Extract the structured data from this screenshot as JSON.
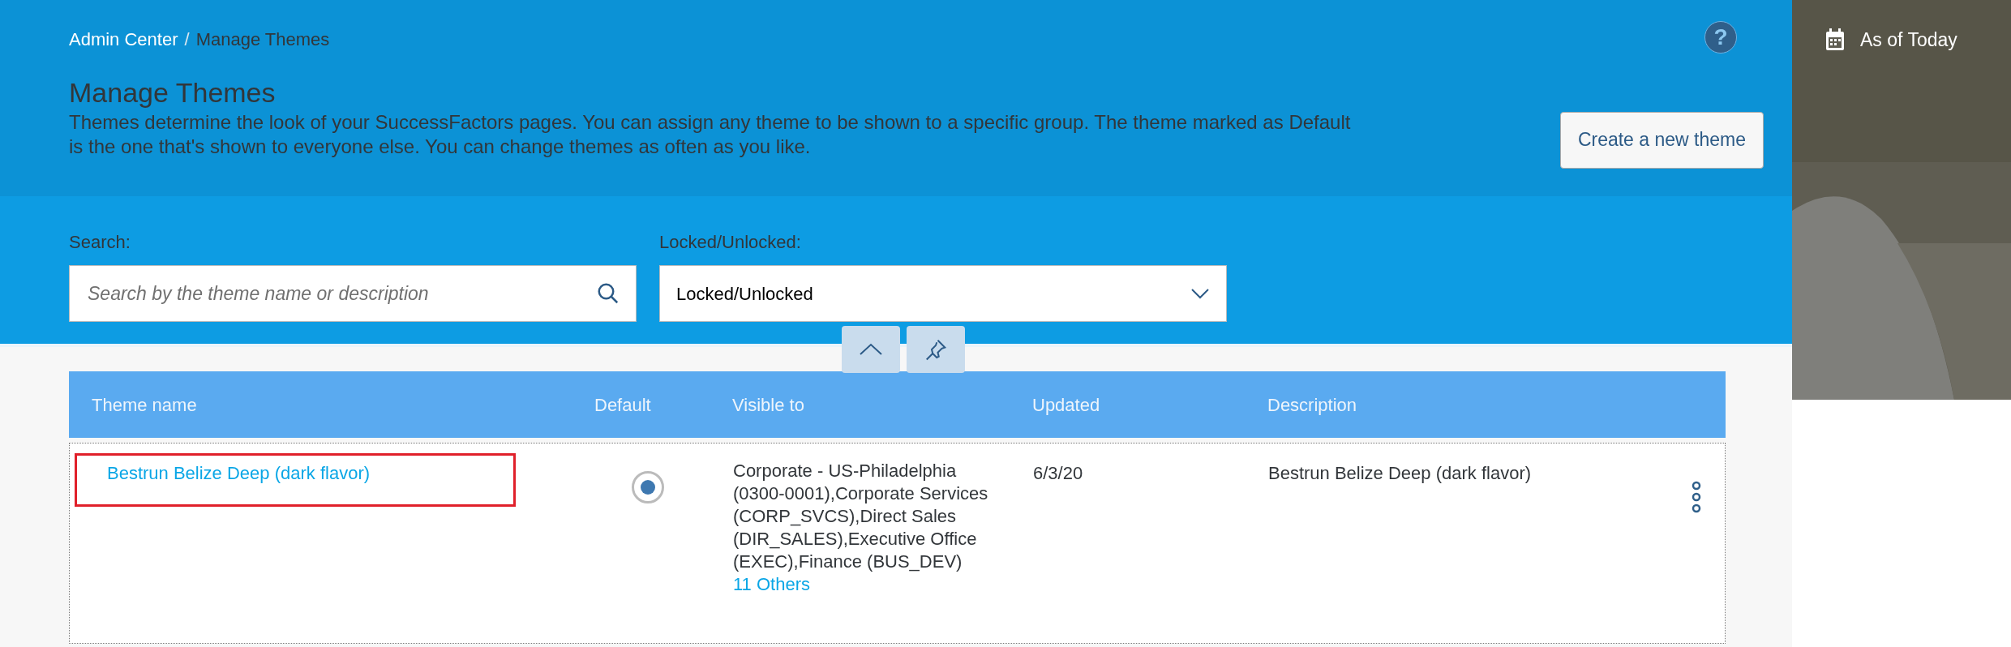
{
  "breadcrumb": {
    "parent": "Admin Center",
    "separator": "/",
    "current": "Manage Themes"
  },
  "header": {
    "title": "Manage Themes",
    "description": "Themes determine the look of your SuccessFactors pages. You can assign any theme to be shown to a specific group. The theme marked as Default is the one that's shown to everyone else. You can change themes as often as you like.",
    "create_button": "Create a new theme"
  },
  "help": "?",
  "side_panel": {
    "date_label": "As of Today",
    "kind": "picture"
  },
  "filters": {
    "search": {
      "label": "Search:",
      "placeholder": "Search by the theme name or description"
    },
    "lock": {
      "label": "Locked/Unlocked:",
      "value": "Locked/Unlocked"
    }
  },
  "table": {
    "columns": [
      "Theme name",
      "Default",
      "Visible to",
      "Updated",
      "Description"
    ],
    "rows": [
      {
        "name": "Bestrun Belize Deep (dark flavor)",
        "highlighted": true,
        "default": true,
        "visible_to": "Corporate - US-Philadelphia (0300-0001),Corporate Services (CORP_SVCS),Direct Sales (DIR_SALES),Executive Office (EXEC),Finance (BUS_DEV)",
        "visible_more": "11 Others",
        "updated": "6/3/20",
        "description": "Bestrun Belize Deep (dark flavor)"
      }
    ]
  }
}
